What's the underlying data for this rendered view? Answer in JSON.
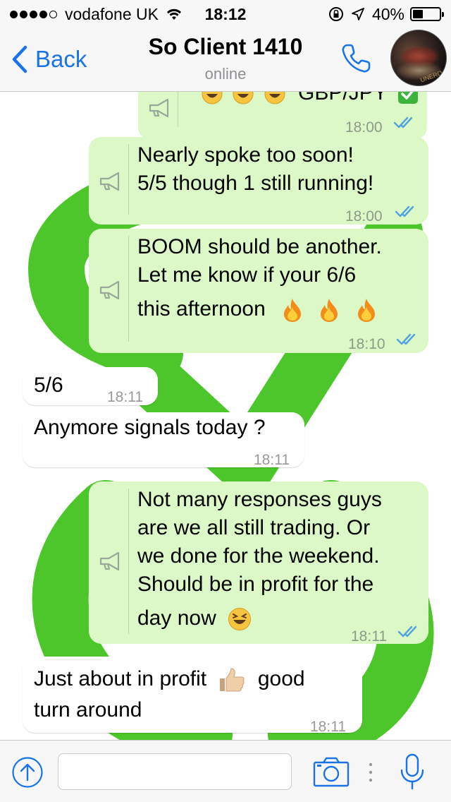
{
  "status_bar": {
    "carrier": "vodafone UK",
    "time": "18:12",
    "battery_percent": "40%",
    "battery_level": 0.4
  },
  "nav": {
    "back_label": "Back",
    "contact_name": "So Client 1410",
    "presence": "online",
    "avatar_text": "UNERO"
  },
  "messages": [
    {
      "direction": "out",
      "text_lines": [
        "GBP/JPY"
      ],
      "emoji": [
        "grinning-emoji",
        "grinning-emoji",
        "grinning-emoji",
        "check-mark-emoji"
      ],
      "time": "18:00",
      "status": "read",
      "broadcast": true
    },
    {
      "direction": "out",
      "text_lines": [
        "Nearly spoke too soon!",
        "5/5 though 1 still running!"
      ],
      "time": "18:00",
      "status": "read",
      "broadcast": true
    },
    {
      "direction": "out",
      "text_lines": [
        "BOOM should be another.",
        "Let me know if your 6/6",
        "this afternoon"
      ],
      "emoji": [
        "fire-emoji",
        "fire-emoji",
        "fire-emoji"
      ],
      "time": "18:10",
      "status": "read",
      "broadcast": true
    },
    {
      "direction": "in",
      "text_lines": [
        "5/6"
      ],
      "time": "18:11"
    },
    {
      "direction": "in",
      "text_lines": [
        "Anymore signals today ?"
      ],
      "time": "18:11"
    },
    {
      "direction": "out",
      "text_lines": [
        "Not many responses guys",
        "are we all still trading. Or",
        "we done for the weekend.",
        "Should be in profit for the",
        "day now"
      ],
      "emoji": [
        "laughing-emoji"
      ],
      "time": "18:11",
      "status": "read",
      "broadcast": true
    },
    {
      "direction": "in",
      "text_lines": [
        "Just about in profit",
        "good",
        "turn around"
      ],
      "emoji": [
        "thumbs-up-emoji"
      ],
      "time": "18:11"
    }
  ],
  "input": {
    "placeholder": "",
    "value": ""
  },
  "colors": {
    "accent": "#1a73e8",
    "outgoing_bubble": "#dcf8c6",
    "incoming_bubble": "#ffffff",
    "read_ticks": "#4fa3e0",
    "wallpaper_green": "#4cc62a"
  },
  "icons": {
    "back": "chevron-left-icon",
    "call": "phone-icon",
    "broadcast": "megaphone-icon",
    "attach": "arrow-up-circle-icon",
    "camera": "camera-icon",
    "mic": "microphone-icon"
  }
}
